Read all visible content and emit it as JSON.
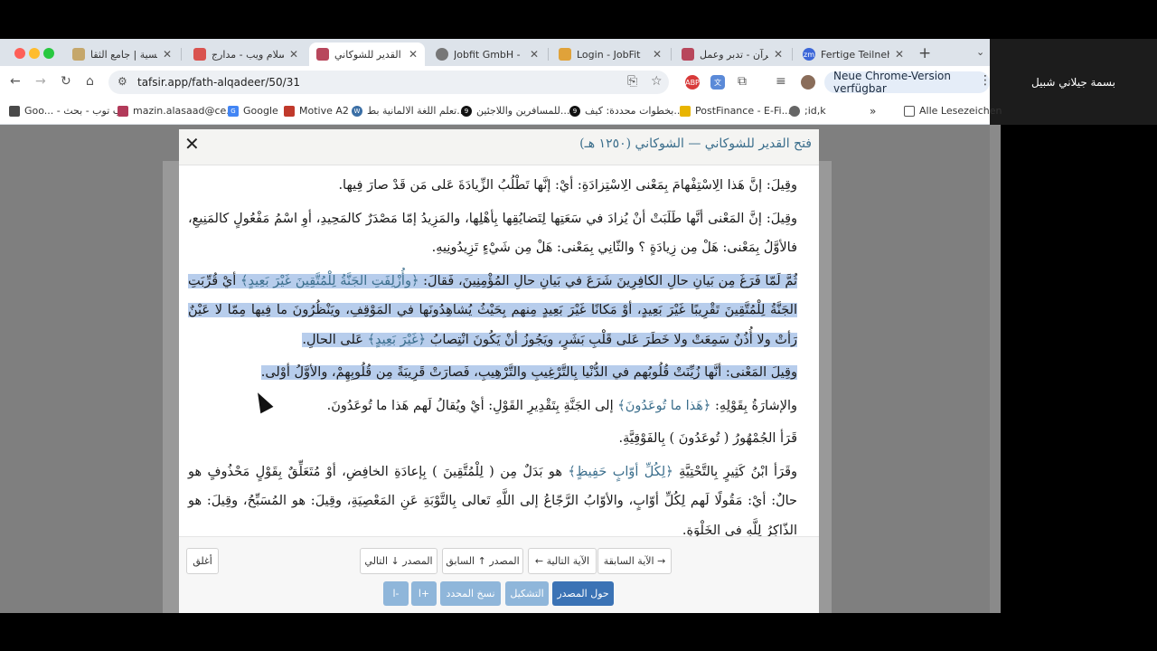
{
  "participant": {
    "name": "بسمة جيلاني شبيل"
  },
  "browser": {
    "tabs": [
      {
        "title": "الرئيسية | جامع الثقا",
        "fav_color": "#c5a76b",
        "active": false
      },
      {
        "title": "إسلام ويب - مدارج",
        "fav_color": "#d9534f",
        "active": false
      },
      {
        "title": "فتح القدير للشوكاني",
        "fav_color": "#b8475c",
        "active": true
      },
      {
        "title": "Jobfit GmbH - Ho",
        "fav_color": "#777777",
        "active": false
      },
      {
        "title": "Login - JobFit",
        "fav_color": "#e0a23a",
        "active": false
      },
      {
        "title": "القرآن - تدبر وعمل",
        "fav_color": "#b8475c",
        "active": false
      },
      {
        "title": "Fertige Teilnehme",
        "fav_color": "#3b66d8",
        "active": false
      }
    ],
    "url": "tafsir.app/fath-alqadeer/50/31",
    "update_label": "Neue Chrome-Version verfügbar",
    "bookmarks": [
      {
        "label": "Goo... - لاب توب - بحث",
        "color": "#4a4a4a"
      },
      {
        "label": "mazin.alasaad@ce...",
        "color": "#b23a5a"
      },
      {
        "label": "Google",
        "color": "#4285f4"
      },
      {
        "label": "Motive A2",
        "color": "#c0392b"
      },
      {
        "label": "تعلم اللغة الالمانية بط...",
        "color": "#3a6ea5"
      },
      {
        "label": "للمسافرين واللاجئين...",
        "color": "#111111"
      },
      {
        "label": "بخطوات محددة: كيف...",
        "color": "#111111"
      },
      {
        "label": "PostFinance - E-Fi...",
        "color": "#e8b400"
      },
      {
        "label": ";id,k",
        "color": "#666666"
      }
    ],
    "all_bookmarks": "Alle Lesezeichen"
  },
  "modal": {
    "title": "فتح القدير للشوكاني — الشوكاني (١٢٥٠ هـ)",
    "paragraphs": [
      {
        "text": "وقِيلَ: إنَّ هَذا الِاسْتِفْهامَ بِمَعْنى الِاسْتِزادَةِ: أيْ: إنَّها تَطْلُبُ الزِّيادَةَ عَلى مَن قَدْ صارَ فِيها."
      },
      {
        "text": "وقِيلَ: إنَّ المَعْنى أنَّها طَلَبَتْ أنْ يُزادَ في سَعَتِها لِتَضايُقِها بِأهْلِها، والمَزِيدُ إمّا مَصْدَرٌ كالمَحِيدِ، أوِ اسْمُ مَفْعُولٍ كالمَنِيعِ، فالأوَّلُ بِمَعْنى: هَلْ مِن زِيادَةٍ ؟ والثّانِي بِمَعْنى: هَلْ مِن شَيْءٍ تَزِيدُونِيهِ."
      },
      {
        "pre": "ثُمَّ لَمّا فَرَغَ مِن بَيانِ حالِ الكافِرِينَ شَرَعَ في بَيانِ حالِ المُؤْمِنِينَ، فَقالَ: ",
        "q1": "﴿وأُزْلِفَتِ الجَنَّةُ لِلْمُتَّقِينَ غَيْرَ بَعِيدٍ﴾",
        "mid": " أيْ قُرِّبَتِ الجَنَّةُ لِلْمُتَّقِينَ تَقْرِيبًا غَيْرَ بَعِيدٍ، أوْ مَكانًا غَيْرَ بَعِيدٍ مِنهم بِحَيْثُ يُشاهِدُونَها في المَوْقِفِ، ويَنْظُرُونَ ما فِيها مِمّا لا عَيْنٌ رَأتْ ولا أُذُنٌ سَمِعَتْ ولا خَطَرَ عَلى قَلْبِ بَشَرٍ، ويَجُوزُ أنْ يَكُونَ انْتِصابُ ",
        "q2": "﴿غَيْرَ بَعِيدٍ﴾",
        "post": " عَلى الحالِ."
      },
      {
        "text": "وقِيلَ المَعْنى: أنَّها زُيِّنَتْ قُلُوبُهم في الدُّنْيا بِالتَّرْغِيبِ والتَّرْهِيبِ، فَصارَتْ قَرِيبَةً مِن قُلُوبِهِمْ، والأوَّلُ أوْلى."
      },
      {
        "pre": "والإشارَةُ بِقَوْلِهِ: ",
        "q1": "﴿هَذا ما تُوعَدُونَ﴾",
        "post": " إلى الجَنَّةِ بِتَقْدِيرِ القَوْلِ: أيْ ويُقالُ لَهم هَذا ما تُوعَدُونَ."
      },
      {
        "text": "قَرَأ الجُمْهُورُ ( تُوعَدُونَ ) بِالفَوْقِيَّةِ."
      },
      {
        "pre": "وقَرَأ ابْنُ كَثِيرٍ بِالتَّحْتِيَّةِ ",
        "q1": "﴿لِكُلِّ أوّابٍ حَفِيظٍ﴾",
        "post": " هو بَدَلٌ مِن ( لِلْمُتَّقِينَ ) بِإعادَةِ الخافِضِ، أوْ مُتَعَلِّقٌ بِقَوْلٍ مَحْذُوفٍ هو حالٌ: أيْ: مَقُولًا لَهم لِكُلِّ أوّابٍ، والأوّابُ الرَّجّاعُ إلى اللَّهِ تَعالى بِالتَّوْبَةِ عَنِ المَعْصِيَةِ، وقِيلَ: هو المُسَبِّحُ، وقِيلَ: هو الذّاكِرُ لِلَّهِ في الخَلْوَةِ."
      }
    ],
    "footer": {
      "close": "أغلق",
      "prev_source": "المصدر ↑ السابق",
      "next_source": "المصدر ↓ التالي",
      "next_ayah": "الآية التالية ←",
      "prev_ayah": "→ الآية السابقة",
      "about_source": "حول المصدر",
      "tashkeel": "التشكيل",
      "copy_selected": "نسخ المحدد",
      "font_plus": "+ا",
      "font_minus": "-ا"
    }
  }
}
